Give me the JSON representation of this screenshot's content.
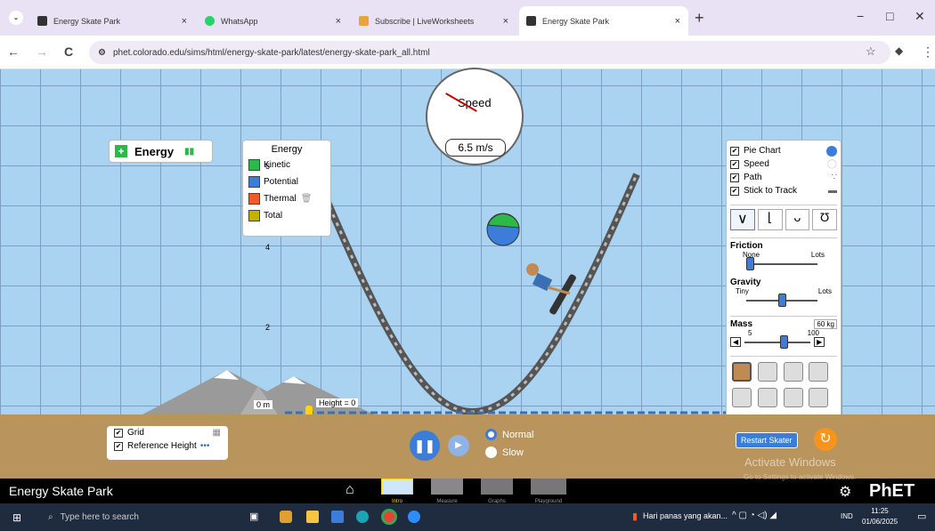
{
  "browser": {
    "tabs": [
      {
        "title": "Energy Skate Park",
        "close": "×",
        "active": false
      },
      {
        "title": "WhatsApp",
        "close": "×",
        "active": false
      },
      {
        "title": "Subscribe | LiveWorksheets",
        "close": "×",
        "active": false
      },
      {
        "title": "Energy Skate Park",
        "close": "×",
        "active": true
      }
    ],
    "new_tab": "+",
    "url": "phet.colorado.edu/sims/html/energy-skate-park/latest/energy-skate-park_all.html",
    "win_min": "−",
    "win_max": "□",
    "win_close": "✕",
    "nav_back": "←",
    "nav_forward": "→",
    "nav_reload": "C"
  },
  "sim": {
    "energy_title": "Energy",
    "legend": {
      "title": "Energy",
      "items": [
        {
          "label": "Kinetic",
          "color": "#2db84a"
        },
        {
          "label": "Potential",
          "color": "#3b7dd8"
        },
        {
          "label": "Thermal",
          "color": "#f05a28"
        },
        {
          "label": "Total",
          "color": "#c2b200"
        }
      ]
    },
    "speedometer": {
      "label": "Speed",
      "value": "6.5 m/s"
    },
    "height_labels": [
      "6",
      "4",
      "2"
    ],
    "zero_label": "0 m",
    "height_marker": "Height = 0",
    "pie": {
      "kinetic_fraction": 0.55
    },
    "controls": {
      "checks": [
        {
          "label": "Pie Chart",
          "checked": true
        },
        {
          "label": "Speed",
          "checked": true
        },
        {
          "label": "Path",
          "checked": true
        },
        {
          "label": "Stick to Track",
          "checked": true
        }
      ],
      "friction": {
        "label": "Friction",
        "min": "None",
        "max": "Lots",
        "level": 0.05
      },
      "gravity": {
        "label": "Gravity",
        "min": "Tiny",
        "max": "Lots",
        "level": 0.5
      },
      "mass": {
        "label": "Mass",
        "value": "60 kg",
        "min": "5",
        "max": "100",
        "level": 0.55
      }
    },
    "grid_panel": {
      "grid": "Grid",
      "ref_height": "Reference Height"
    },
    "speed_options": [
      {
        "label": "Normal",
        "selected": true
      },
      {
        "label": "Slow",
        "selected": false
      }
    ],
    "restart": "Restart Skater",
    "watermark": {
      "line1": "Activate Windows",
      "line2": "Go to Settings to activate Windows."
    }
  },
  "app": {
    "title": "Energy Skate Park",
    "screens": [
      "Intro",
      "Measure",
      "Graphs",
      "Playground"
    ],
    "active_screen": "Intro",
    "brand": "PhET"
  },
  "taskbar": {
    "search_placeholder": "Type here to search",
    "weather": "Hari panas yang akan...",
    "lang": "IND",
    "time": "11:25",
    "date": "01/06/2025"
  },
  "colors": {
    "sky": "#a9d3f0",
    "ground": "#b9945c",
    "track": "#6b6b6b"
  }
}
